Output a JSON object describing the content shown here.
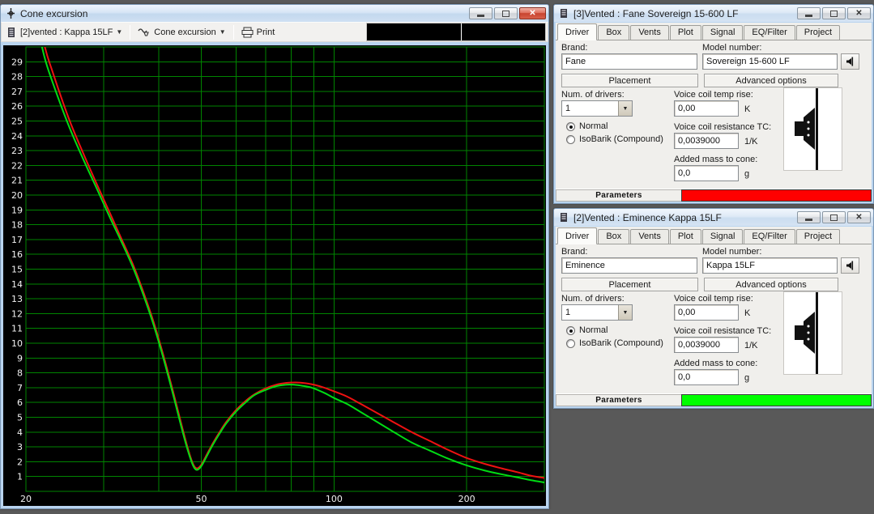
{
  "app": {
    "background": "#595959"
  },
  "plot_window": {
    "title": "Cone excursion",
    "toolbar": {
      "driver_select": "[2]vented : Kappa 15LF",
      "graph_select": "Cone excursion",
      "print_label": "Print"
    },
    "chart_data": {
      "type": "line",
      "title": "Cone excursion",
      "x_scale": "log",
      "x_range": [
        20,
        300
      ],
      "y_range": [
        0,
        30
      ],
      "x_gridlines": [
        20,
        30,
        40,
        50,
        60,
        70,
        80,
        90,
        100,
        200,
        300
      ],
      "x_tick_labels": [
        20,
        50,
        100,
        200
      ],
      "y_tick_labels": [
        1,
        2,
        3,
        4,
        5,
        6,
        7,
        8,
        9,
        10,
        11,
        12,
        13,
        14,
        15,
        16,
        17,
        18,
        19,
        20,
        21,
        22,
        23,
        24,
        25,
        26,
        27,
        28,
        29
      ],
      "grid_color": "#008400",
      "background": "#000000",
      "tick_text_color": "#f2f2f2",
      "series": [
        {
          "name": "Fane Sovereign 15-600 LF",
          "color": "#ee1111",
          "points": [
            [
              20,
              38
            ],
            [
              21,
              33.5
            ],
            [
              22,
              30.2
            ],
            [
              23,
              28.3
            ],
            [
              25,
              25.2
            ],
            [
              27,
              22.8
            ],
            [
              29,
              20.7
            ],
            [
              31,
              18.8
            ],
            [
              33,
              17
            ],
            [
              35,
              15.3
            ],
            [
              37,
              13.4
            ],
            [
              39,
              11.4
            ],
            [
              41,
              9.2
            ],
            [
              43,
              6.9
            ],
            [
              45,
              4.6
            ],
            [
              46.5,
              3
            ],
            [
              47.8,
              1.9
            ],
            [
              48.8,
              1.55
            ],
            [
              50,
              1.8
            ],
            [
              51.5,
              2.5
            ],
            [
              53,
              3.2
            ],
            [
              55,
              4
            ],
            [
              57,
              4.7
            ],
            [
              60,
              5.5
            ],
            [
              63,
              6.1
            ],
            [
              66,
              6.55
            ],
            [
              70,
              6.95
            ],
            [
              74,
              7.2
            ],
            [
              78,
              7.32
            ],
            [
              82,
              7.35
            ],
            [
              86,
              7.3
            ],
            [
              90,
              7.2
            ],
            [
              95,
              7
            ],
            [
              100,
              6.75
            ],
            [
              107,
              6.4
            ],
            [
              115,
              5.9
            ],
            [
              125,
              5.3
            ],
            [
              135,
              4.75
            ],
            [
              150,
              4
            ],
            [
              165,
              3.4
            ],
            [
              180,
              2.85
            ],
            [
              200,
              2.25
            ],
            [
              220,
              1.85
            ],
            [
              240,
              1.55
            ],
            [
              260,
              1.3
            ],
            [
              280,
              1.05
            ],
            [
              300,
              0.9
            ]
          ]
        },
        {
          "name": "Eminence Kappa 15LF",
          "color": "#00dc14",
          "points": [
            [
              20,
              36
            ],
            [
              21,
              32.2
            ],
            [
              22,
              29.4
            ],
            [
              23,
              27.6
            ],
            [
              25,
              24.7
            ],
            [
              27,
              22.4
            ],
            [
              29,
              20.4
            ],
            [
              31,
              18.5
            ],
            [
              33,
              16.8
            ],
            [
              35,
              15.1
            ],
            [
              37,
              13.2
            ],
            [
              39,
              11.2
            ],
            [
              41,
              9
            ],
            [
              43,
              6.7
            ],
            [
              45,
              4.4
            ],
            [
              46.5,
              2.85
            ],
            [
              47.8,
              1.8
            ],
            [
              48.8,
              1.45
            ],
            [
              50,
              1.7
            ],
            [
              51.5,
              2.4
            ],
            [
              53,
              3.1
            ],
            [
              55,
              3.9
            ],
            [
              57,
              4.6
            ],
            [
              60,
              5.4
            ],
            [
              63,
              6
            ],
            [
              66,
              6.5
            ],
            [
              70,
              6.85
            ],
            [
              74,
              7.1
            ],
            [
              78,
              7.2
            ],
            [
              81,
              7.2
            ],
            [
              85,
              7.12
            ],
            [
              89,
              7
            ],
            [
              95,
              6.65
            ],
            [
              100,
              6.3
            ],
            [
              107,
              5.9
            ],
            [
              115,
              5.35
            ],
            [
              125,
              4.7
            ],
            [
              135,
              4.1
            ],
            [
              150,
              3.3
            ],
            [
              165,
              2.75
            ],
            [
              180,
              2.25
            ],
            [
              200,
              1.75
            ],
            [
              220,
              1.4
            ],
            [
              240,
              1.15
            ],
            [
              260,
              0.95
            ],
            [
              280,
              0.75
            ],
            [
              300,
              0.6
            ]
          ]
        }
      ]
    }
  },
  "driver_windows": [
    {
      "title": "[3]Vented : Fane Sovereign 15-600 LF",
      "tabs": [
        "Driver",
        "Box",
        "Vents",
        "Plot",
        "Signal",
        "EQ/Filter",
        "Project"
      ],
      "active_tab": "Driver",
      "brand_label": "Brand:",
      "brand": "Fane",
      "model_label": "Model number:",
      "model": "Sovereign 15-600 LF",
      "placement_label": "Placement",
      "advanced_label": "Advanced options",
      "num_drivers_label": "Num. of drivers:",
      "num_drivers": "1",
      "radio_normal": "Normal",
      "radio_isobarik": "IsoBarik (Compound)",
      "vc_temp_label": "Voice coil temp rise:",
      "vc_temp": "0,00",
      "vc_temp_unit": "K",
      "vc_res_label": "Voice coil resistance TC:",
      "vc_res": "0,0039000",
      "vc_res_unit": "1/K",
      "added_mass_label": "Added mass to cone:",
      "added_mass": "0,0",
      "added_mass_unit": "g",
      "status_label": "Parameters",
      "status_color": "#ff0000"
    },
    {
      "title": "[2]Vented : Eminence Kappa 15LF",
      "tabs": [
        "Driver",
        "Box",
        "Vents",
        "Plot",
        "Signal",
        "EQ/Filter",
        "Project"
      ],
      "active_tab": "Driver",
      "brand_label": "Brand:",
      "brand": "Eminence",
      "model_label": "Model number:",
      "model": "Kappa 15LF",
      "placement_label": "Placement",
      "advanced_label": "Advanced options",
      "num_drivers_label": "Num. of drivers:",
      "num_drivers": "1",
      "radio_normal": "Normal",
      "radio_isobarik": "IsoBarik (Compound)",
      "vc_temp_label": "Voice coil temp rise:",
      "vc_temp": "0,00",
      "vc_temp_unit": "K",
      "vc_res_label": "Voice coil resistance TC:",
      "vc_res": "0,0039000",
      "vc_res_unit": "1/K",
      "added_mass_label": "Added mass to cone:",
      "added_mass": "0,0",
      "added_mass_unit": "g",
      "status_label": "Parameters",
      "status_color": "#00ff00"
    }
  ]
}
